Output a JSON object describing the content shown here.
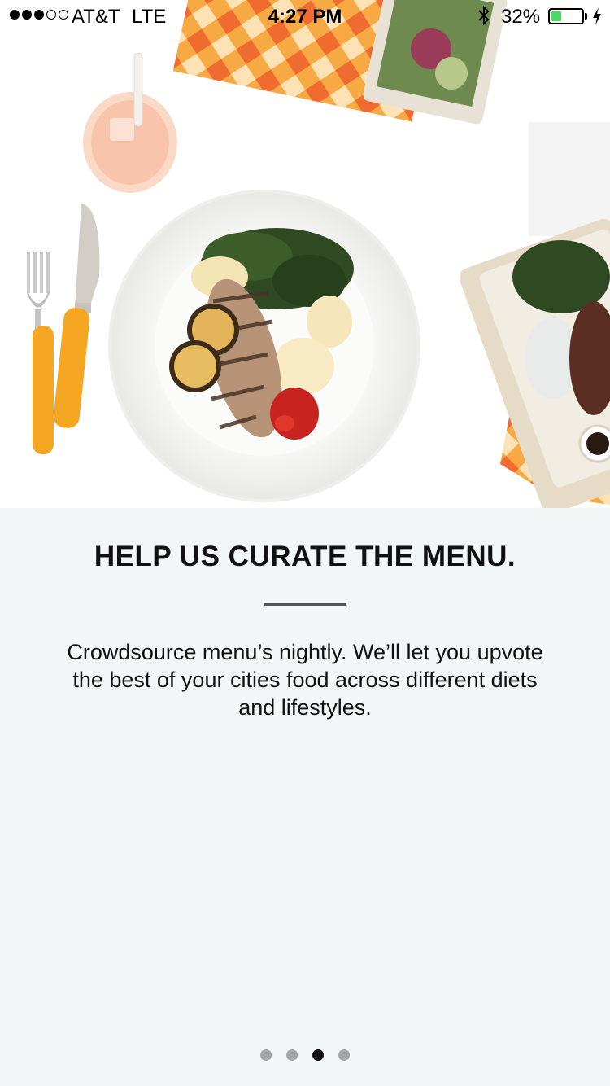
{
  "status_bar": {
    "signal_bars_filled": 3,
    "signal_bars_total": 5,
    "carrier": "AT&T",
    "network": "LTE",
    "time": "4:27 PM",
    "bluetooth_icon": "bluetooth-icon",
    "battery_percent_text": "32%",
    "battery_level": 0.32,
    "charging_icon": "bolt-icon",
    "battery_color": "#4cd964"
  },
  "hero": {
    "image": "food-plate-photo"
  },
  "onboarding": {
    "title": "HELP US CURATE THE MENU.",
    "description": "Crowdsource menu’s nightly. We’ll let you upvote the best of your cities food across different diets and lifestyles."
  },
  "pager": {
    "page_count": 4,
    "current_page": 3
  },
  "colors": {
    "background": "#f3f6f7",
    "accent_orange": "#f5a623",
    "text": "#111111"
  }
}
